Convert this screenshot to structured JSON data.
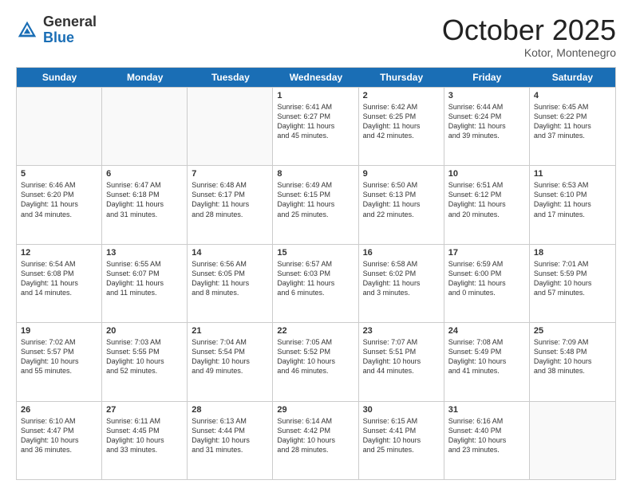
{
  "logo": {
    "general": "General",
    "blue": "Blue"
  },
  "title": "October 2025",
  "location": "Kotor, Montenegro",
  "header_days": [
    "Sunday",
    "Monday",
    "Tuesday",
    "Wednesday",
    "Thursday",
    "Friday",
    "Saturday"
  ],
  "weeks": [
    [
      {
        "day": "",
        "info": ""
      },
      {
        "day": "",
        "info": ""
      },
      {
        "day": "",
        "info": ""
      },
      {
        "day": "1",
        "info": "Sunrise: 6:41 AM\nSunset: 6:27 PM\nDaylight: 11 hours\nand 45 minutes."
      },
      {
        "day": "2",
        "info": "Sunrise: 6:42 AM\nSunset: 6:25 PM\nDaylight: 11 hours\nand 42 minutes."
      },
      {
        "day": "3",
        "info": "Sunrise: 6:44 AM\nSunset: 6:24 PM\nDaylight: 11 hours\nand 39 minutes."
      },
      {
        "day": "4",
        "info": "Sunrise: 6:45 AM\nSunset: 6:22 PM\nDaylight: 11 hours\nand 37 minutes."
      }
    ],
    [
      {
        "day": "5",
        "info": "Sunrise: 6:46 AM\nSunset: 6:20 PM\nDaylight: 11 hours\nand 34 minutes."
      },
      {
        "day": "6",
        "info": "Sunrise: 6:47 AM\nSunset: 6:18 PM\nDaylight: 11 hours\nand 31 minutes."
      },
      {
        "day": "7",
        "info": "Sunrise: 6:48 AM\nSunset: 6:17 PM\nDaylight: 11 hours\nand 28 minutes."
      },
      {
        "day": "8",
        "info": "Sunrise: 6:49 AM\nSunset: 6:15 PM\nDaylight: 11 hours\nand 25 minutes."
      },
      {
        "day": "9",
        "info": "Sunrise: 6:50 AM\nSunset: 6:13 PM\nDaylight: 11 hours\nand 22 minutes."
      },
      {
        "day": "10",
        "info": "Sunrise: 6:51 AM\nSunset: 6:12 PM\nDaylight: 11 hours\nand 20 minutes."
      },
      {
        "day": "11",
        "info": "Sunrise: 6:53 AM\nSunset: 6:10 PM\nDaylight: 11 hours\nand 17 minutes."
      }
    ],
    [
      {
        "day": "12",
        "info": "Sunrise: 6:54 AM\nSunset: 6:08 PM\nDaylight: 11 hours\nand 14 minutes."
      },
      {
        "day": "13",
        "info": "Sunrise: 6:55 AM\nSunset: 6:07 PM\nDaylight: 11 hours\nand 11 minutes."
      },
      {
        "day": "14",
        "info": "Sunrise: 6:56 AM\nSunset: 6:05 PM\nDaylight: 11 hours\nand 8 minutes."
      },
      {
        "day": "15",
        "info": "Sunrise: 6:57 AM\nSunset: 6:03 PM\nDaylight: 11 hours\nand 6 minutes."
      },
      {
        "day": "16",
        "info": "Sunrise: 6:58 AM\nSunset: 6:02 PM\nDaylight: 11 hours\nand 3 minutes."
      },
      {
        "day": "17",
        "info": "Sunrise: 6:59 AM\nSunset: 6:00 PM\nDaylight: 11 hours\nand 0 minutes."
      },
      {
        "day": "18",
        "info": "Sunrise: 7:01 AM\nSunset: 5:59 PM\nDaylight: 10 hours\nand 57 minutes."
      }
    ],
    [
      {
        "day": "19",
        "info": "Sunrise: 7:02 AM\nSunset: 5:57 PM\nDaylight: 10 hours\nand 55 minutes."
      },
      {
        "day": "20",
        "info": "Sunrise: 7:03 AM\nSunset: 5:55 PM\nDaylight: 10 hours\nand 52 minutes."
      },
      {
        "day": "21",
        "info": "Sunrise: 7:04 AM\nSunset: 5:54 PM\nDaylight: 10 hours\nand 49 minutes."
      },
      {
        "day": "22",
        "info": "Sunrise: 7:05 AM\nSunset: 5:52 PM\nDaylight: 10 hours\nand 46 minutes."
      },
      {
        "day": "23",
        "info": "Sunrise: 7:07 AM\nSunset: 5:51 PM\nDaylight: 10 hours\nand 44 minutes."
      },
      {
        "day": "24",
        "info": "Sunrise: 7:08 AM\nSunset: 5:49 PM\nDaylight: 10 hours\nand 41 minutes."
      },
      {
        "day": "25",
        "info": "Sunrise: 7:09 AM\nSunset: 5:48 PM\nDaylight: 10 hours\nand 38 minutes."
      }
    ],
    [
      {
        "day": "26",
        "info": "Sunrise: 6:10 AM\nSunset: 4:47 PM\nDaylight: 10 hours\nand 36 minutes."
      },
      {
        "day": "27",
        "info": "Sunrise: 6:11 AM\nSunset: 4:45 PM\nDaylight: 10 hours\nand 33 minutes."
      },
      {
        "day": "28",
        "info": "Sunrise: 6:13 AM\nSunset: 4:44 PM\nDaylight: 10 hours\nand 31 minutes."
      },
      {
        "day": "29",
        "info": "Sunrise: 6:14 AM\nSunset: 4:42 PM\nDaylight: 10 hours\nand 28 minutes."
      },
      {
        "day": "30",
        "info": "Sunrise: 6:15 AM\nSunset: 4:41 PM\nDaylight: 10 hours\nand 25 minutes."
      },
      {
        "day": "31",
        "info": "Sunrise: 6:16 AM\nSunset: 4:40 PM\nDaylight: 10 hours\nand 23 minutes."
      },
      {
        "day": "",
        "info": ""
      }
    ]
  ]
}
